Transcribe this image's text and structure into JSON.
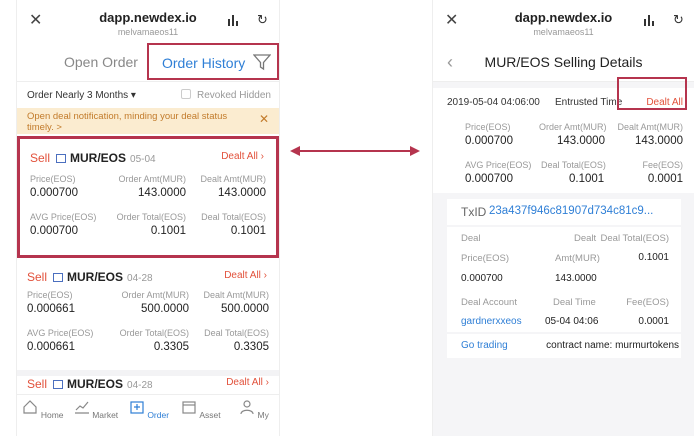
{
  "left": {
    "topbar": {
      "title": "dapp.newdex.io",
      "subtitle": "melvamaeos11"
    },
    "tabs": {
      "open": "Open Order",
      "history": "Order History"
    },
    "filter": {
      "period": "Order Nearly 3 Months ▾",
      "revoked": "Revoked Hidden"
    },
    "notice": {
      "line1": "Open deal notification, minding your deal status",
      "line2": "timely. >"
    },
    "orders": [
      {
        "side": "Sell",
        "pair": "MUR/EOS",
        "date": "05-04",
        "status": "Dealt All ›",
        "labels": [
          "Price(EOS)",
          "Order Amt(MUR)",
          "Dealt Amt(MUR)",
          "AVG Price(EOS)",
          "Order Total(EOS)",
          "Deal Total(EOS)"
        ],
        "values": [
          "0.000700",
          "143.0000",
          "143.0000",
          "0.000700",
          "0.1001",
          "0.1001"
        ]
      },
      {
        "side": "Sell",
        "pair": "MUR/EOS",
        "date": "04-28",
        "status": "Dealt All ›",
        "labels": [
          "Price(EOS)",
          "Order Amt(MUR)",
          "Dealt Amt(MUR)",
          "AVG Price(EOS)",
          "Order Total(EOS)",
          "Deal Total(EOS)"
        ],
        "values": [
          "0.000661",
          "500.0000",
          "500.0000",
          "0.000661",
          "0.3305",
          "0.3305"
        ]
      },
      {
        "side": "Sell",
        "pair": "MUR/EOS",
        "date": "04-28",
        "status": "Dealt All ›"
      }
    ],
    "nav": [
      "Home",
      "Market",
      "Order",
      "Asset",
      "My"
    ]
  },
  "right": {
    "topbar": {
      "title": "dapp.newdex.io",
      "subtitle": "melvamaeos11"
    },
    "header": "MUR/EOS Selling Details",
    "entrusted": {
      "time": "2019-05-04 04:06:00",
      "label": "Entrusted Time",
      "status": "Dealt All"
    },
    "summary": {
      "labels": [
        "Price(EOS)",
        "Order Amt(MUR)",
        "Dealt Amt(MUR)",
        "AVG Price(EOS)",
        "Deal Total(EOS)",
        "Fee(EOS)"
      ],
      "values": [
        "0.000700",
        "143.0000",
        "143.0000",
        "0.000700",
        "0.1001",
        "0.0001"
      ]
    },
    "txid": {
      "label": "TxID",
      "value": "23a437f946c81907d734c81c9..."
    },
    "deal": {
      "h1": "Deal",
      "h2": "Dealt",
      "h3": "Deal Total(EOS)",
      "l1": "Price(EOS)",
      "l2": "Amt(MUR)",
      "v3": "0.1001",
      "v1": "0.000700",
      "v2": "143.0000",
      "l4": "Deal Account",
      "l5": "Deal Time",
      "l6": "Fee(EOS)",
      "v4": "gardnerxxeos",
      "v5": "05-04 04:06",
      "v6": "0.0001"
    },
    "footer": {
      "link": "Go trading",
      "contract": "contract name: murmurtokens"
    }
  },
  "colors": {
    "accent": "#2f7fd6",
    "sell": "#e2513b",
    "highlight": "#b5344e"
  }
}
